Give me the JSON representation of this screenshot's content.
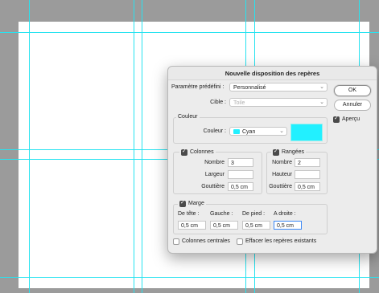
{
  "dialog": {
    "title": "Nouvelle disposition des repères",
    "preset_label": "Paramètre prédéfini :",
    "preset_value": "Personnalisé",
    "target_label": "Cible :",
    "target_value": "Toile",
    "ok_label": "OK",
    "cancel_label": "Annuler",
    "preview_label": "Aperçu",
    "preview_checked": true,
    "color_group": "Couleur",
    "color_label": "Couleur :",
    "color_value": "Cyan",
    "color_hex": "#22f0ff",
    "columns": {
      "label": "Colonnes",
      "checked": true,
      "number_label": "Nombre",
      "number_value": "3",
      "width_label": "Largeur",
      "width_value": "",
      "gutter_label": "Gouttière",
      "gutter_value": "0,5 cm"
    },
    "rows": {
      "label": "Rangées",
      "checked": true,
      "number_label": "Nombre",
      "number_value": "2",
      "height_label": "Hauteur",
      "height_value": "",
      "gutter_label": "Gouttière",
      "gutter_value": "0,5 cm"
    },
    "margin": {
      "label": "Marge",
      "checked": true,
      "top_label": "De tête :",
      "left_label": "Gauche :",
      "bottom_label": "De pied :",
      "right_label": "A droite :",
      "top_value": "0,5 cm",
      "left_value": "0,5 cm",
      "bottom_value": "0,5 cm",
      "right_value": "0,5 cm"
    },
    "center_columns_label": "Colonnes centrales",
    "center_columns_checked": false,
    "clear_guides_label": "Effacer les repères existants",
    "clear_guides_checked": false
  },
  "colors": {
    "guide": "#27e3f0",
    "canvas_background": "#9b9b9b",
    "document": "#ffffff",
    "dialog_background": "#ececec",
    "focus": "#3b87f5"
  }
}
